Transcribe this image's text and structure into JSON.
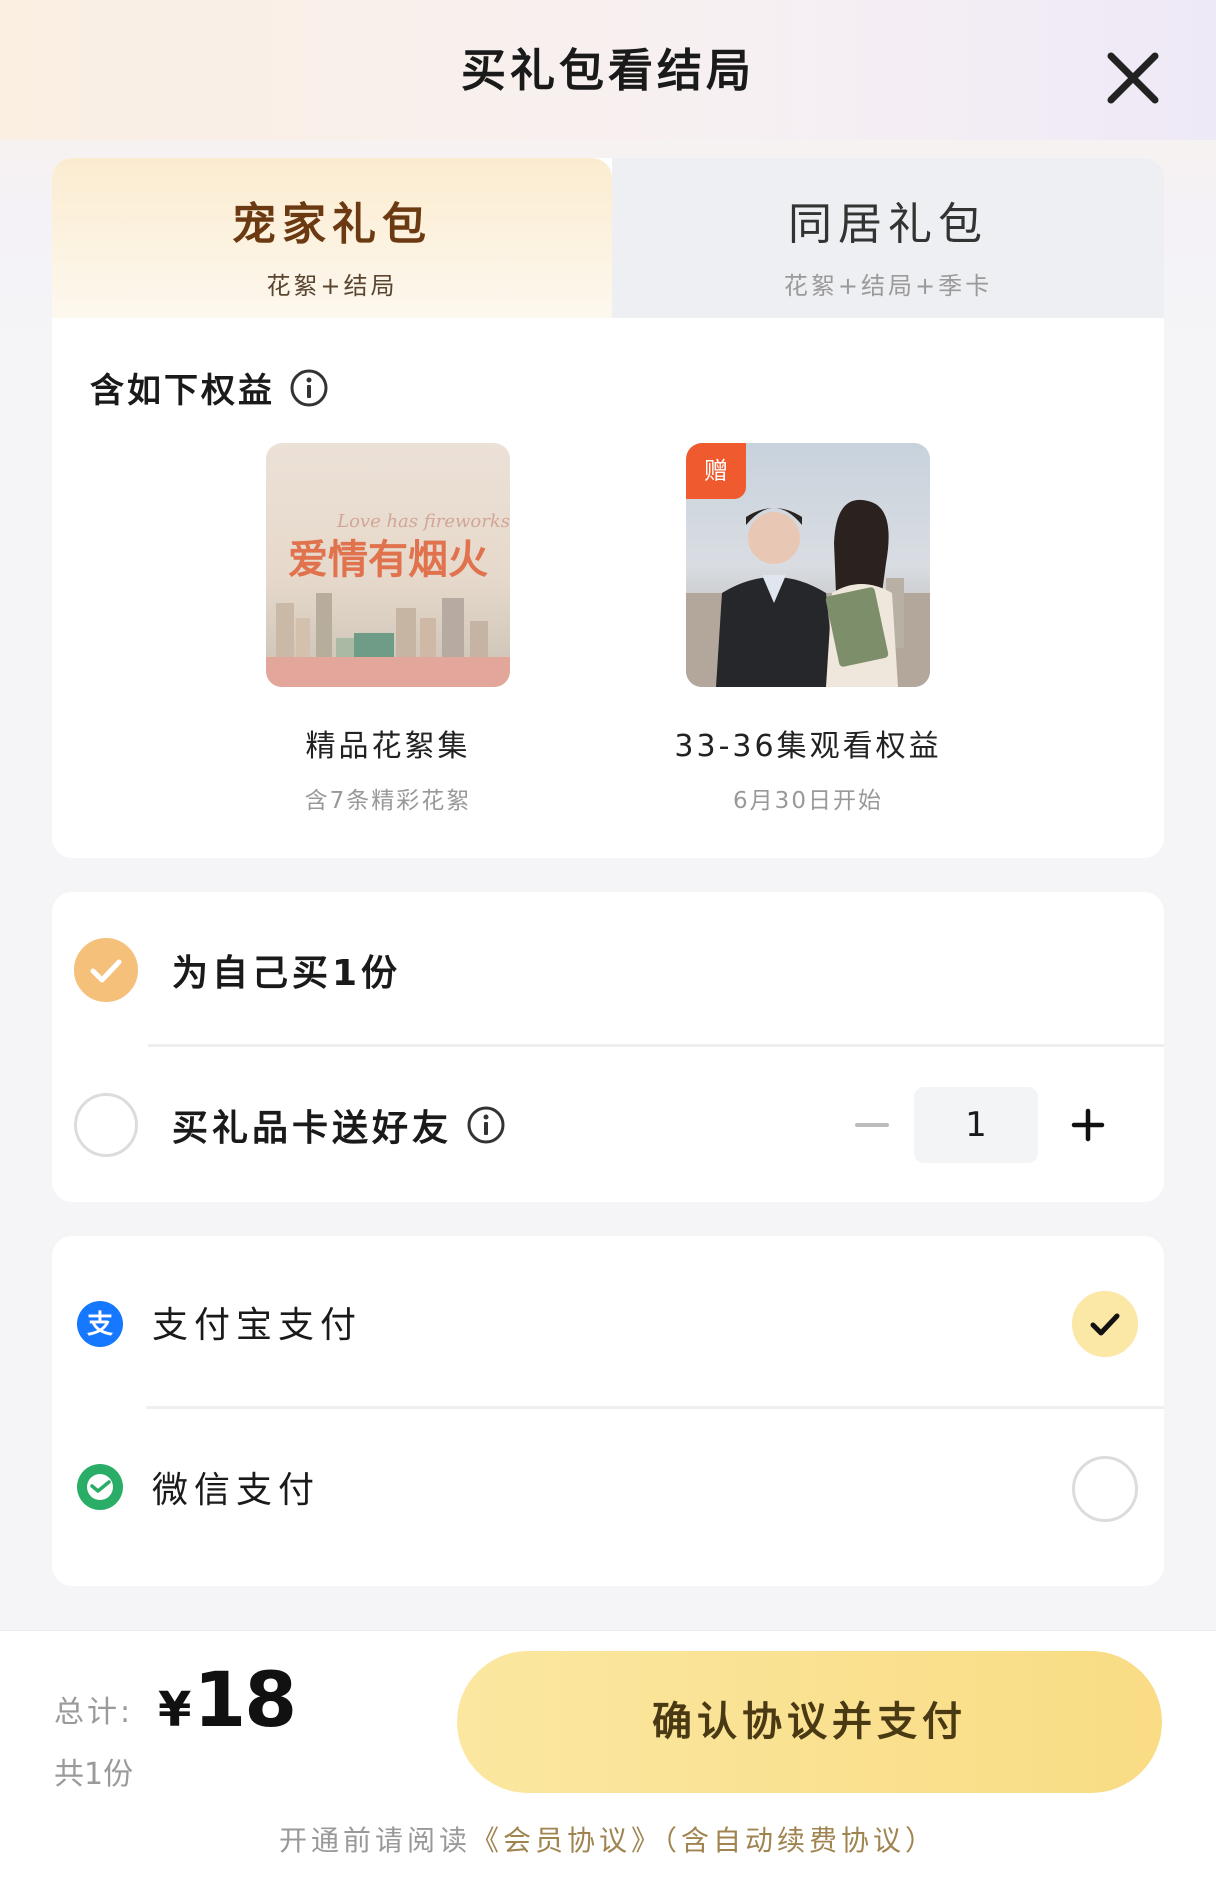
{
  "header": {
    "title": "买礼包看结局"
  },
  "tabs": [
    {
      "name": "宠家礼包",
      "sub": "花絮+结局"
    },
    {
      "name": "同居礼包",
      "sub": "花絮+结局+季卡"
    }
  ],
  "benefits": {
    "heading": "含如下权益",
    "items": [
      {
        "name": "精品花絮集",
        "desc": "含7条精彩花絮",
        "poster_title": "爱情有烟火",
        "poster_subtitle": "Love has fireworks"
      },
      {
        "name": "33-36集观看权益",
        "desc": "6月30日开始",
        "badge": "赠"
      }
    ]
  },
  "purchase": {
    "self_label": "为自己买1份",
    "gift_label": "买礼品卡送好友",
    "quantity": "1"
  },
  "payment": {
    "alipay_label": "支付宝支付",
    "wechat_label": "微信支付"
  },
  "footer": {
    "total_label": "总计:",
    "currency": "¥",
    "price": "18",
    "count_label": "共1份",
    "pay_button": "确认协议并支付",
    "agreement_prefix": "开通前请阅读",
    "agreement_link1": "《会员协议》",
    "agreement_link2": "（含自动续费协议）"
  },
  "colors": {
    "accent": "#f4c07a",
    "button": "#f9dc84",
    "gift_badge": "#ef5a2f",
    "alipay": "#1677ff",
    "wechat": "#2aae67"
  }
}
